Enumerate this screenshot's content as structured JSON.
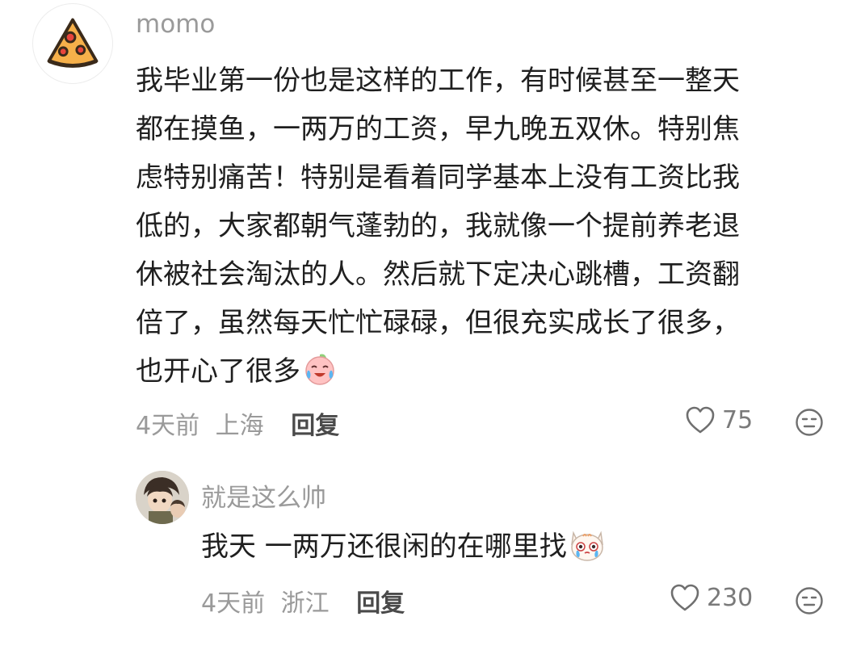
{
  "comment": {
    "username": "momo",
    "avatar_icon": "pizza-slice-icon",
    "lines": [
      "我毕业第一份也是这样的工作，有时候甚至一整天",
      "都在摸鱼，一两万的工资，早九晚五双休。特别焦",
      "虑特别痛苦！特别是看着同学基本上没有工资比我",
      "低的，大家都朝气蓬勃的，我就像一个提前养老退",
      "休被社会淘汰的人。然后就下定决心跳槽，工资翻",
      "倍了，虽然每天忙忙碌碌，但很充实成长了很多，",
      "也开心了很多"
    ],
    "emoji": "laughing-crying-peach-emoji",
    "time": "4天前",
    "location": "上海",
    "reply_label": "回复",
    "likes": "75"
  },
  "reply": {
    "username": "就是这么帅",
    "avatar_icon": "anime-character-avatar",
    "text": "我天 一两万还很闲的在哪里找",
    "emoji": "crying-cat-emoji",
    "time": "4天前",
    "location": "浙江",
    "reply_label": "回复",
    "likes": "230"
  },
  "colors": {
    "text": "#1f1f1f",
    "meta": "#9a9a9a",
    "reply_action": "#4a4a4a"
  }
}
